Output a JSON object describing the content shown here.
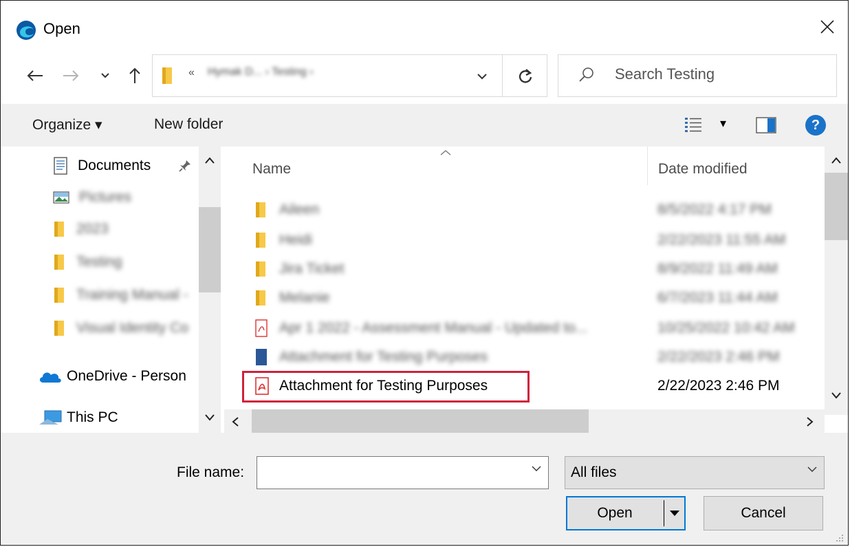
{
  "window": {
    "title": "Open",
    "close_glyph": "✕"
  },
  "nav": {
    "back_glyph": "←",
    "forward_glyph": "→",
    "recent_glyph": "⌄",
    "up_glyph": "↑"
  },
  "address": {
    "chevron": "«",
    "breadcrumb": "Hymak D... › Testing ›",
    "refresh_glyph": "↻"
  },
  "search": {
    "placeholder": "Search Testing"
  },
  "toolbar": {
    "organize_label": "Organize ▾",
    "new_folder_label": "New folder",
    "view_dropdown": "▾",
    "help_glyph": "?"
  },
  "nav_pane": {
    "items": [
      {
        "label": "Documents",
        "icon": "documents-icon",
        "pinned": true
      },
      {
        "label": "Pictures",
        "icon": "pictures-icon",
        "blurred": true
      },
      {
        "label": "2023",
        "icon": "folder-icon",
        "blurred": true
      },
      {
        "label": "Testing",
        "icon": "folder-icon",
        "blurred": true
      },
      {
        "label": "Training Manual -",
        "icon": "folder-icon",
        "blurred": true
      },
      {
        "label": "Visual Identity Co",
        "icon": "folder-icon",
        "blurred": true
      },
      {
        "label": "OneDrive - Person",
        "icon": "onedrive-icon"
      },
      {
        "label": "This PC",
        "icon": "this-pc-icon"
      }
    ]
  },
  "columns": {
    "name": "Name",
    "date": "Date modified"
  },
  "files": [
    {
      "name": "Aileen",
      "date": "8/5/2022 4:17 PM",
      "type": "folder",
      "blurred": true
    },
    {
      "name": "Heidi",
      "date": "2/22/2023 11:55 AM",
      "type": "folder",
      "blurred": true
    },
    {
      "name": "Jira Ticket",
      "date": "8/9/2022 11:49 AM",
      "type": "folder",
      "blurred": true
    },
    {
      "name": "Melanie",
      "date": "6/7/2023 11:44 AM",
      "type": "folder",
      "blurred": true
    },
    {
      "name": "Apr 1 2022 - Assessment Manual - Updated to...",
      "date": "10/25/2022 10:42 AM",
      "type": "pdf",
      "blurred": true
    },
    {
      "name": "Attachment for Testing Purposes",
      "date": "2/22/2023 2:46 PM",
      "type": "word",
      "blurred": true
    },
    {
      "name": "Attachment for Testing Purposes",
      "date": "2/22/2023 2:46 PM",
      "type": "pdf",
      "highlighted": true
    }
  ],
  "scroll": {
    "left": "‹",
    "right": "›",
    "up": "^",
    "down": "⌄"
  },
  "bottom": {
    "file_name_label": "File name:",
    "file_name_value": "",
    "file_type_value": "All files",
    "open_label": "Open",
    "cancel_label": "Cancel"
  },
  "colors": {
    "accent": "#0078d7",
    "highlight_box": "#d0213b",
    "folder": "#f7c948"
  }
}
